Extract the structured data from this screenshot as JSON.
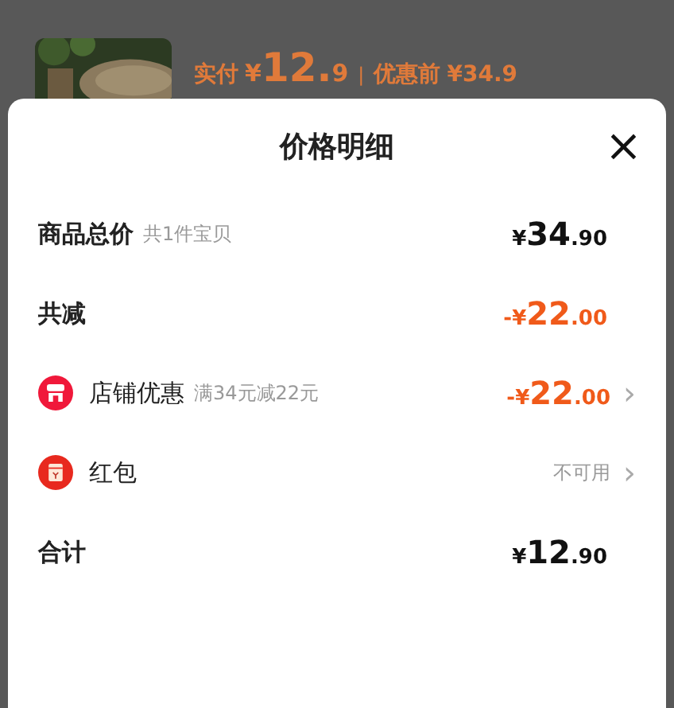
{
  "background": {
    "product": {
      "kind": "picture",
      "paid_label": "实付",
      "paid_symbol": "¥",
      "paid_main": "12.",
      "paid_fraction": "9",
      "separator": "|",
      "before_label": "优惠前",
      "before_price": "¥34.9"
    }
  },
  "sheet": {
    "title": "价格明细",
    "close": "×",
    "rows": [
      {
        "kind": "subtotal",
        "label": "商品总价",
        "note": "共1件宝贝",
        "symbol": "¥",
        "main": "34",
        "fraction": ".90"
      },
      {
        "kind": "reduction",
        "label": "共减",
        "symbol": "-¥",
        "main": "22",
        "fraction": ".00"
      },
      {
        "kind": "store_coupon",
        "label": "店铺优惠",
        "note": "满34元减22元",
        "symbol": "-¥",
        "main": "22",
        "fraction": ".00",
        "chevron": "›"
      },
      {
        "kind": "envelope",
        "label": "红包",
        "status": "不可用",
        "chevron": "›"
      },
      {
        "kind": "total",
        "label": "合计",
        "symbol": "¥",
        "main": "12",
        "fraction": ".90"
      }
    ]
  }
}
